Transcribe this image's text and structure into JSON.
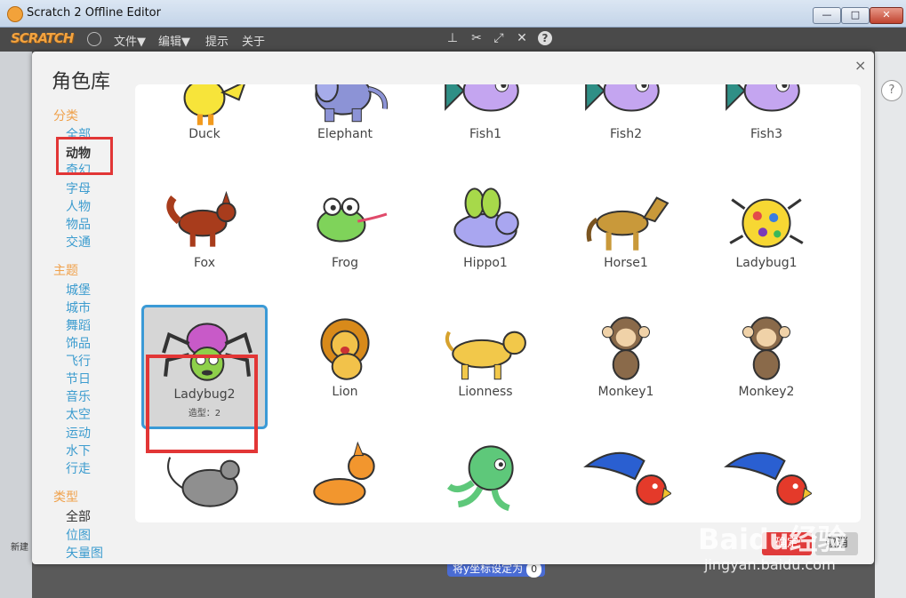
{
  "window": {
    "title": "Scratch 2 Offline Editor",
    "minimize": "—",
    "maximize": "□",
    "close": "✕"
  },
  "menubar": {
    "logo": "SCRATCH",
    "items": [
      "文件▼",
      "编辑▼",
      "提示",
      "关于"
    ],
    "tools": [
      "stamp-icon",
      "cut-icon",
      "grow-icon",
      "shrink-icon",
      "help-icon"
    ]
  },
  "background": {
    "block_text": "将y坐标设定为",
    "block_value": "0",
    "new_label": "新建"
  },
  "dialog": {
    "title": "角色库",
    "close": "×",
    "sidebar": {
      "category_heading": "分类",
      "categories": [
        "全部",
        "动物",
        "奇幻",
        "字母",
        "人物",
        "物品",
        "交通"
      ],
      "selected_category": "动物",
      "theme_heading": "主题",
      "themes": [
        "城堡",
        "城市",
        "舞蹈",
        "饰品",
        "飞行",
        "节日",
        "音乐",
        "太空",
        "运动",
        "水下",
        "行走"
      ],
      "type_heading": "类型",
      "types": [
        "全部",
        "位图",
        "矢量图"
      ],
      "selected_type": "全部"
    },
    "sprites": [
      {
        "name": "Duck",
        "icon": "duck"
      },
      {
        "name": "Elephant",
        "icon": "elephant"
      },
      {
        "name": "Fish1",
        "icon": "fish"
      },
      {
        "name": "Fish2",
        "icon": "fish"
      },
      {
        "name": "Fish3",
        "icon": "fish"
      },
      {
        "name": "Fox",
        "icon": "fox"
      },
      {
        "name": "Frog",
        "icon": "frog"
      },
      {
        "name": "Hippo1",
        "icon": "hippo"
      },
      {
        "name": "Horse1",
        "icon": "horse"
      },
      {
        "name": "Ladybug1",
        "icon": "ladybug"
      },
      {
        "name": "Ladybug2",
        "icon": "spider",
        "costumes": "造型：2",
        "selected": true
      },
      {
        "name": "Lion",
        "icon": "lion"
      },
      {
        "name": "Lionness",
        "icon": "lioness"
      },
      {
        "name": "Monkey1",
        "icon": "monkey"
      },
      {
        "name": "Monkey2",
        "icon": "monkey"
      },
      {
        "name": "",
        "icon": "mouse"
      },
      {
        "name": "",
        "icon": "cat-pony"
      },
      {
        "name": "",
        "icon": "octopus"
      },
      {
        "name": "",
        "icon": "parrot"
      },
      {
        "name": "",
        "icon": "parrot"
      }
    ],
    "ok_label": "确定",
    "cancel_label": "取消"
  },
  "watermark": {
    "brand": "Baidu经验",
    "url": "jingyan.baidu.com"
  },
  "colors": {
    "accent_blue": "#3c9ccf",
    "heading_orange": "#f0a14b",
    "highlight_red": "#e23636"
  }
}
